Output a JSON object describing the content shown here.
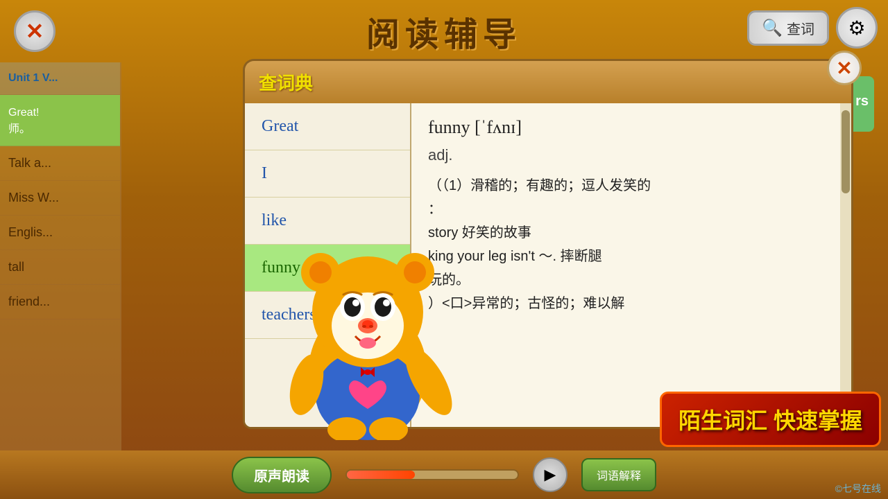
{
  "app": {
    "title": "阅读辅导",
    "close_label": "✕",
    "search_label": "查词",
    "settings_label": "⚙"
  },
  "sidebar": {
    "items": [
      {
        "label": "Unit 1 V...",
        "type": "unit"
      },
      {
        "label": "Great!\n师。",
        "type": "highlighted"
      },
      {
        "label": "Talk a...",
        "type": "normal"
      },
      {
        "label": "Miss W...",
        "type": "normal"
      },
      {
        "label": "Englis...",
        "type": "normal"
      },
      {
        "label": "tall",
        "type": "normal"
      },
      {
        "label": "friend...",
        "type": "normal"
      }
    ]
  },
  "dictionary": {
    "title": "查词典",
    "close_label": "✕",
    "words": [
      {
        "word": "Great",
        "active": false
      },
      {
        "word": "I",
        "active": false
      },
      {
        "word": "like",
        "active": false
      },
      {
        "word": "funny",
        "active": true
      },
      {
        "word": "teachers",
        "active": false
      }
    ],
    "definition": {
      "word": "funny",
      "phonetic": "funny  [ˈfʌnɪ]",
      "pos": "adj.",
      "meanings": [
        "（（1）滑稽的；有趣的；逗人发笑的",
        "：",
        "story 好笑的故事",
        "king your leg isn't ～. 摔断腿",
        "玩的。",
        "）<口>异常的；古怪的；难以解"
      ]
    }
  },
  "bottom_bar": {
    "read_aloud_label": "原声朗读",
    "play_icon": "▶",
    "progress_percent": 40
  },
  "vocab_banner": {
    "text": "陌生词汇 快速掌握"
  },
  "watermark": {
    "text": "©七号在线"
  },
  "right_area": {
    "suffix_label": "rs"
  }
}
